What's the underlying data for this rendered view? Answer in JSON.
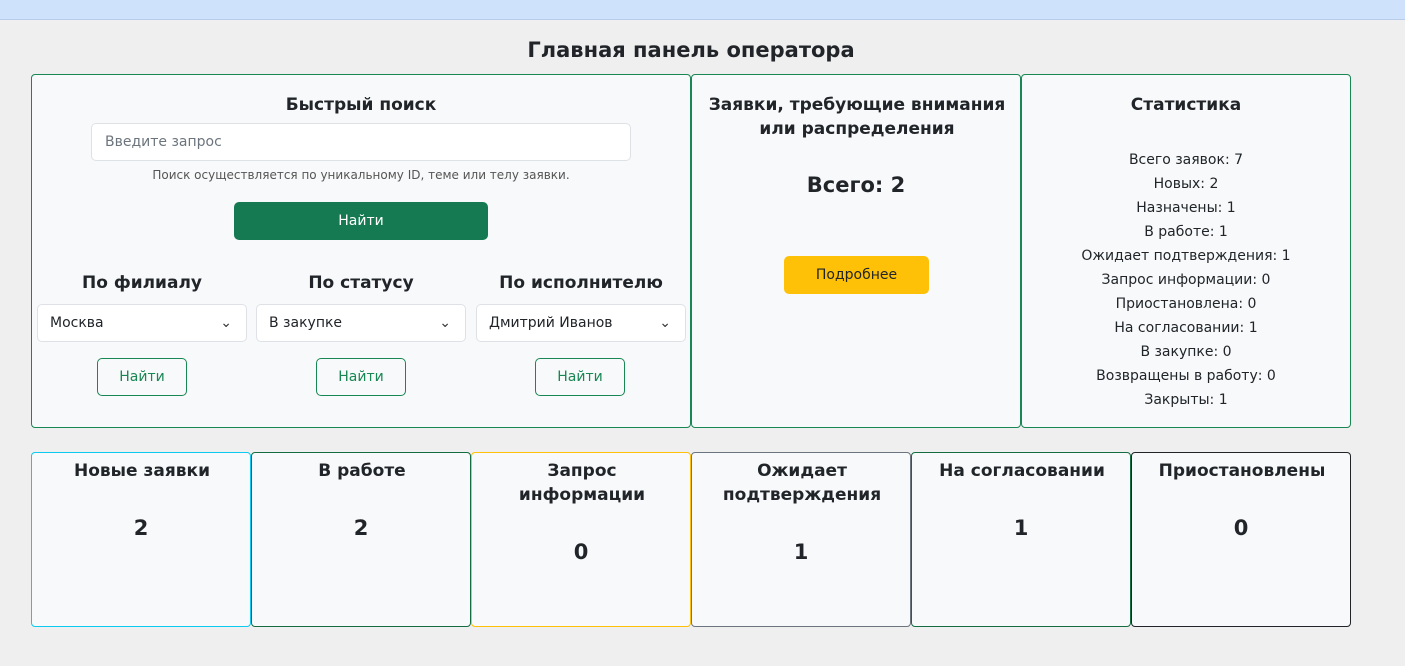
{
  "page_title": "Главная панель оператора",
  "search": {
    "title": "Быстрый поиск",
    "placeholder": "Введите запрос",
    "help": "Поиск осуществляется по уникальному ID, теме или телу заявки.",
    "button": "Найти"
  },
  "filters": [
    {
      "label": "По филиалу",
      "value": "Москва",
      "button": "Найти"
    },
    {
      "label": "По статусу",
      "value": "В закупке",
      "button": "Найти"
    },
    {
      "label": "По исполнителю",
      "value": "Дмитрий Иванов",
      "button": "Найти"
    }
  ],
  "attention": {
    "title": "Заявки, требующие внимания или распределения",
    "total": "Всего: 2",
    "button": "Подробнее"
  },
  "stats": {
    "title": "Статистика",
    "items": [
      "Всего заявок: 7",
      "Новых: 2",
      "Назначены: 1",
      "В работе: 1",
      "Ожидает подтверждения: 1",
      "Запрос информации: 0",
      "Приостановлена: 0",
      "На согласовании: 1",
      "В закупке: 0",
      "Возвращены в работу: 0",
      "Закрыты: 1"
    ]
  },
  "status_cards": [
    {
      "title": "Новые заявки",
      "count": "2",
      "border": "#0dcaf0"
    },
    {
      "title": "В работе",
      "count": "2",
      "border": "#146c43"
    },
    {
      "title": "Запрос информации",
      "count": "0",
      "border": "#ffc107"
    },
    {
      "title": "Ожидает подтверждения",
      "count": "1",
      "border": "#6c757d"
    },
    {
      "title": "На согласовании",
      "count": "1",
      "border": "#146c43"
    },
    {
      "title": "Приостановлены",
      "count": "0",
      "border": "#212529"
    }
  ],
  "colors": {
    "primary": "#157a52",
    "success_border": "#198754",
    "warning": "#ffc107",
    "topbar": "#cfe2fb"
  }
}
